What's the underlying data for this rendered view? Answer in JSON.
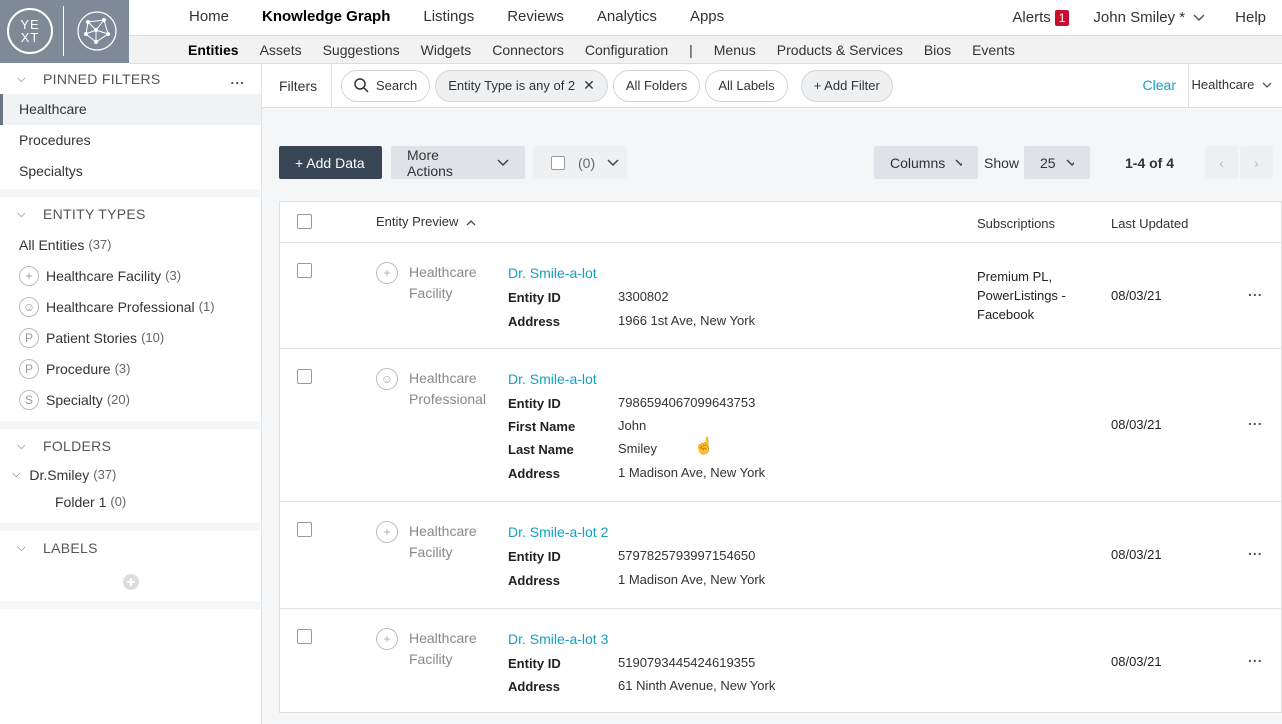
{
  "logo": {
    "text_top": "YE",
    "text_bottom": "XT"
  },
  "nav": {
    "items": [
      "Home",
      "Knowledge Graph",
      "Listings",
      "Reviews",
      "Analytics",
      "Apps"
    ],
    "active": "Knowledge Graph",
    "alerts_label": "Alerts",
    "alerts_count": "1",
    "user": "John Smiley *",
    "help": "Help"
  },
  "subnav": {
    "items": [
      "Entities",
      "Assets",
      "Suggestions",
      "Widgets",
      "Connectors",
      "Configuration",
      "|",
      "Menus",
      "Products & Services",
      "Bios",
      "Events"
    ]
  },
  "sidebar": {
    "pinned_title": "PINNED FILTERS",
    "pinned_more": "...",
    "pinned": [
      "Healthcare",
      "Procedures",
      "Specialtys"
    ],
    "entity_types_title": "ENTITY TYPES",
    "all_entities": "All Entities",
    "all_count": "(37)",
    "entity_types": [
      {
        "icon": "+",
        "label": "Healthcare Facility",
        "count": "(3)"
      },
      {
        "icon": "☺",
        "label": "Healthcare Professional",
        "count": "(1)"
      },
      {
        "icon": "P",
        "label": "Patient Stories",
        "count": "(10)"
      },
      {
        "icon": "P",
        "label": "Procedure",
        "count": "(3)"
      },
      {
        "icon": "S",
        "label": "Specialty",
        "count": "(20)"
      }
    ],
    "folders_title": "FOLDERS",
    "folder_root": "Dr.Smiley",
    "folder_root_count": "(37)",
    "folder_child": "Folder 1",
    "folder_child_count": "(0)",
    "labels_title": "LABELS"
  },
  "filters": {
    "label": "Filters",
    "search": "Search",
    "entity_type": "Entity Type is any of 2",
    "folders": "All Folders",
    "labels": "All Labels",
    "add": "+ Add Filter",
    "clear": "Clear",
    "saved": "Healthcare"
  },
  "toolbar": {
    "add_data": "+ Add Data",
    "more_actions": "More Actions",
    "selected": "(0)",
    "columns": "Columns",
    "show_label": "Show",
    "show_value": "25",
    "range": "1-4 of 4"
  },
  "table": {
    "headers": {
      "preview": "Entity Preview",
      "subscriptions": "Subscriptions",
      "updated": "Last Updated"
    },
    "rows": [
      {
        "type_l1": "Healthcare",
        "type_l2": "Facility",
        "name": "Dr. Smile-a-lot",
        "f1": "Entity ID",
        "v1": "3300802",
        "f2": "Address",
        "v2": "1966 1st Ave, New York",
        "subs": [
          "Premium PL,",
          "PowerListings -",
          "Facebook"
        ],
        "updated": "08/03/21"
      },
      {
        "type_l1": "Healthcare",
        "type_l2": "Professional",
        "name": "Dr. Smile-a-lot",
        "f1": "Entity ID",
        "v1": "7986594067099643753",
        "f2": "First Name",
        "v2": "John",
        "f3": "Last Name",
        "v3": "Smiley",
        "f4": "Address",
        "v4": "1 Madison Ave, New York",
        "updated": "08/03/21"
      },
      {
        "type_l1": "Healthcare",
        "type_l2": "Facility",
        "name": "Dr. Smile-a-lot 2",
        "f1": "Entity ID",
        "v1": "5797825793997154650",
        "f2": "Address",
        "v2": "1 Madison Ave, New York",
        "updated": "08/03/21"
      },
      {
        "type_l1": "Healthcare",
        "type_l2": "Facility",
        "name": "Dr. Smile-a-lot 3",
        "f1": "Entity ID",
        "v1": "5190793445424619355",
        "f2": "Address",
        "v2": "61 Ninth Avenue, New York",
        "updated": "08/03/21"
      }
    ],
    "row_menu": "..."
  }
}
